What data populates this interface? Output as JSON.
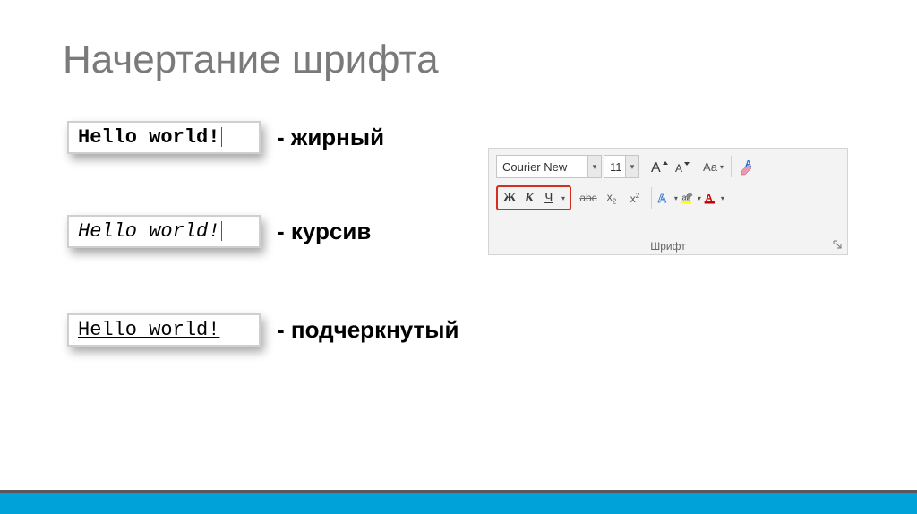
{
  "title": "Начертание шрифта",
  "examples": {
    "bold": {
      "text": "Hello world!",
      "label": "- жирный"
    },
    "italic": {
      "text": "Hello world!",
      "label": "- курсив"
    },
    "underline": {
      "text": "Hello world!",
      "label": "- подчеркнутый"
    }
  },
  "ribbon": {
    "fontName": "Courier New",
    "fontSize": "11",
    "groupLabel": "Шрифт",
    "buttons": {
      "bold": "Ж",
      "italic": "К",
      "underline": "Ч",
      "strike": "abc",
      "changeCase": "Aa",
      "growA": "A",
      "shrinkA": "A"
    }
  },
  "chart_data": null
}
